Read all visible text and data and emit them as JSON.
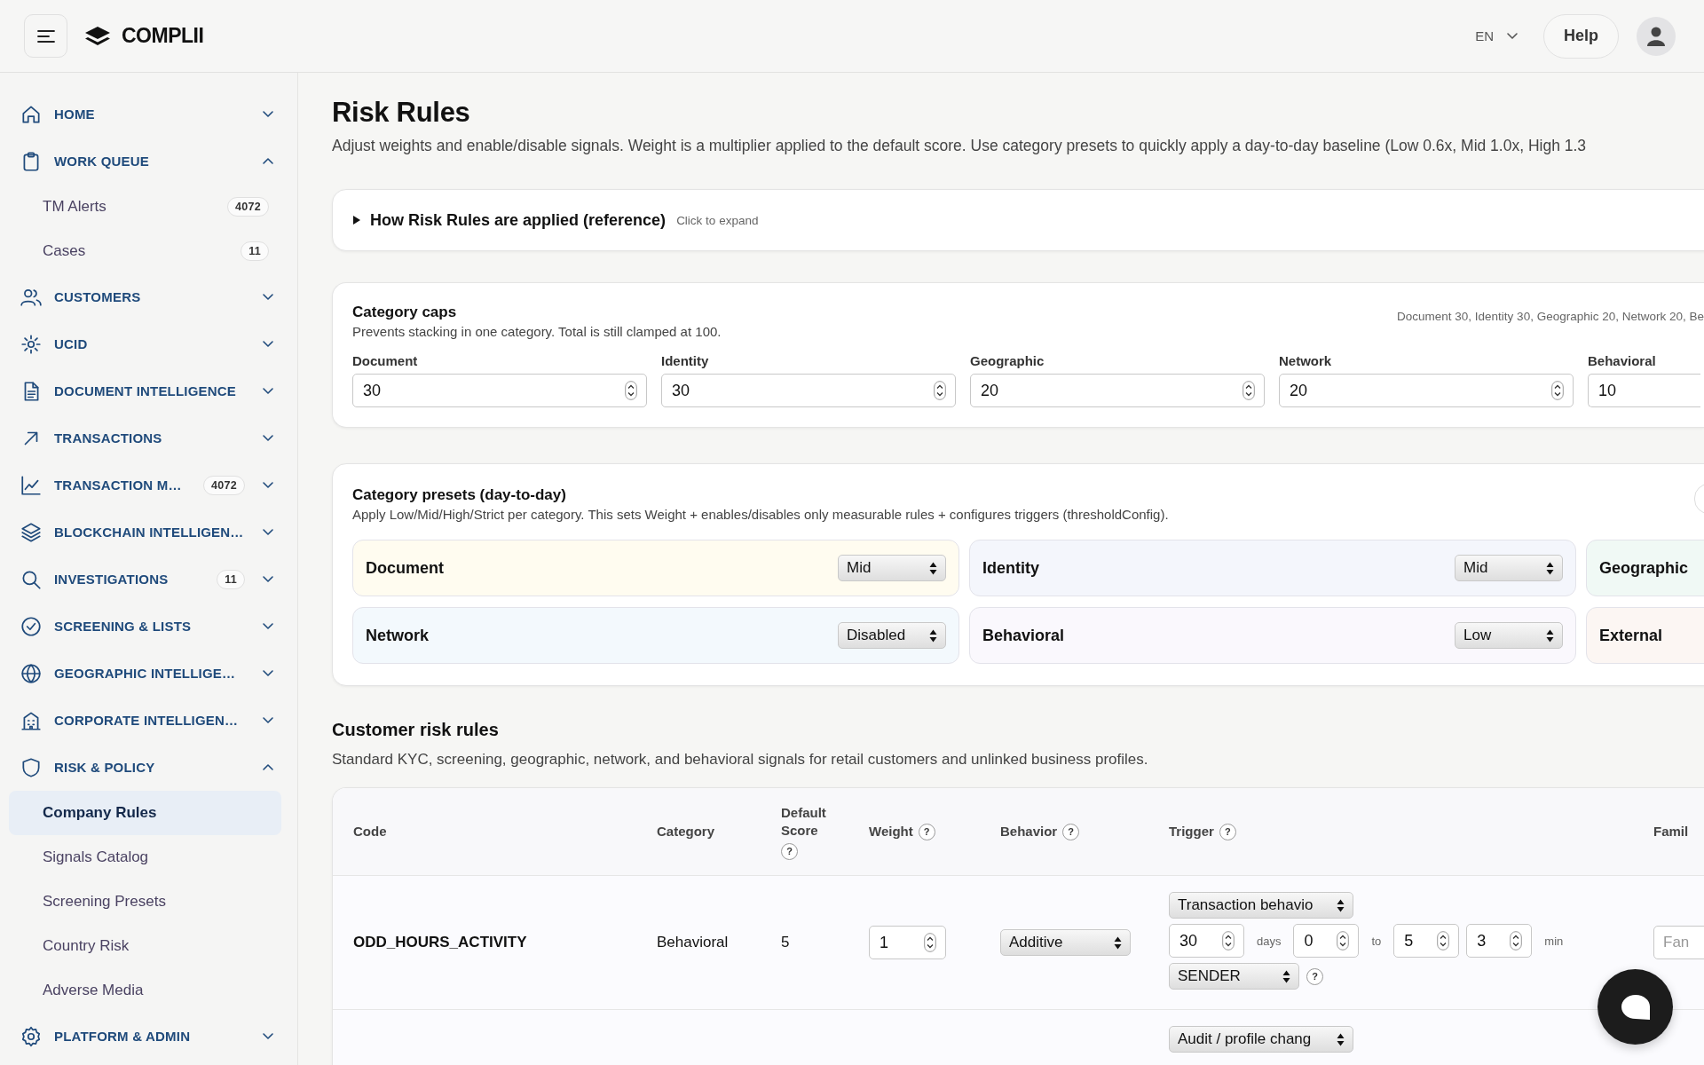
{
  "header": {
    "brand": "COMPLII",
    "language": "EN",
    "help": "Help"
  },
  "sidebar": {
    "items": [
      {
        "label": "HOME",
        "expanded": false
      },
      {
        "label": "WORK QUEUE",
        "expanded": true,
        "children": [
          {
            "label": "TM Alerts",
            "badge": "4072",
            "selected": false
          },
          {
            "label": "Cases",
            "badge": "11",
            "selected": false
          }
        ]
      },
      {
        "label": "CUSTOMERS",
        "expanded": false
      },
      {
        "label": "UCID",
        "expanded": false
      },
      {
        "label": "DOCUMENT INTELLIGENCE",
        "expanded": false
      },
      {
        "label": "TRANSACTIONS",
        "expanded": false
      },
      {
        "label": "TRANSACTION M…",
        "badge": "4072",
        "expanded": false
      },
      {
        "label": "BLOCKCHAIN INTELLIGEN…",
        "expanded": false
      },
      {
        "label": "INVESTIGATIONS",
        "badge": "11",
        "expanded": false
      },
      {
        "label": "SCREENING & LISTS",
        "expanded": false
      },
      {
        "label": "GEOGRAPHIC INTELLIGE…",
        "expanded": false
      },
      {
        "label": "CORPORATE INTELLIGEN…",
        "expanded": false
      },
      {
        "label": "RISK & POLICY",
        "expanded": true,
        "children": [
          {
            "label": "Company Rules",
            "selected": true
          },
          {
            "label": "Signals Catalog",
            "selected": false
          },
          {
            "label": "Screening Presets",
            "selected": false
          },
          {
            "label": "Country Risk",
            "selected": false
          },
          {
            "label": "Adverse Media",
            "selected": false
          }
        ]
      },
      {
        "label": "PLATFORM & ADMIN",
        "expanded": false
      }
    ]
  },
  "page": {
    "title": "Risk Rules",
    "description": "Adjust weights and enable/disable signals. Weight is a multiplier applied to the default score. Use category presets to quickly apply a day-to-day baseline (Low 0.6x, Mid 1.0x, High 1.3"
  },
  "reference_panel": {
    "title": "How Risk Rules are applied (reference)",
    "hint": "Click to expand",
    "expanded": false
  },
  "category_caps": {
    "title": "Category caps",
    "description": "Prevents stacking in one category. Total is still clamped at 100.",
    "summary": "Document 30, Identity 30, Geographic 20, Network 20, Be",
    "fields": [
      {
        "label": "Document",
        "value": "30"
      },
      {
        "label": "Identity",
        "value": "30"
      },
      {
        "label": "Geographic",
        "value": "20"
      },
      {
        "label": "Network",
        "value": "20"
      },
      {
        "label": "Behavioral",
        "value": "10"
      }
    ]
  },
  "category_presets": {
    "title": "Category presets (day-to-day)",
    "description": "Apply Low/Mid/High/Strict per category. This sets Weight + enables/disables only measurable rules + configures triggers (thresholdConfig).",
    "tiles": [
      {
        "label": "Document",
        "value": "Mid",
        "color": "#fffcf0"
      },
      {
        "label": "Identity",
        "value": "Mid",
        "color": "#f4f6fc"
      },
      {
        "label": "Geographic",
        "color": "#f0f9f5"
      },
      {
        "label": "Network",
        "value": "Disabled",
        "color": "#f3f9fd"
      },
      {
        "label": "Behavioral",
        "value": "Low",
        "color": "#faf8fd"
      },
      {
        "label": "External",
        "color": "#fcf6f3"
      }
    ]
  },
  "customer_rules": {
    "title": "Customer risk rules",
    "description": "Standard KYC, screening, geographic, network, and behavioral signals for retail customers and unlinked business profiles.",
    "columns": [
      {
        "label": "Code"
      },
      {
        "label": "Category"
      },
      {
        "label": "Default Score",
        "help": "?"
      },
      {
        "label": "Weight",
        "help": "?"
      },
      {
        "label": "Behavior",
        "help": "?"
      },
      {
        "label": "Trigger",
        "help": "?"
      },
      {
        "label": "Famil"
      }
    ],
    "rows": [
      {
        "code": "ODD_HOURS_ACTIVITY",
        "category": "Behavioral",
        "default_score": "5",
        "weight": "1",
        "behavior": "Additive",
        "trigger": [
          [
            {
              "kind": "select",
              "value": "Transaction behavio"
            }
          ],
          [
            {
              "kind": "number",
              "value": "30"
            },
            {
              "kind": "unit",
              "text": "days"
            },
            {
              "kind": "number",
              "value": "0"
            },
            {
              "kind": "unit",
              "text": "to"
            },
            {
              "kind": "number",
              "value": "5"
            },
            {
              "kind": "number",
              "value": "3"
            },
            {
              "kind": "unit",
              "text": "min"
            }
          ],
          [
            {
              "kind": "select",
              "value": "SENDER"
            },
            {
              "kind": "help",
              "text": "?"
            }
          ]
        ],
        "family": {
          "placeholder": "Fan"
        }
      },
      {
        "trigger": [
          [
            {
              "kind": "select",
              "value": "Audit / profile chang"
            }
          ]
        ]
      }
    ]
  }
}
